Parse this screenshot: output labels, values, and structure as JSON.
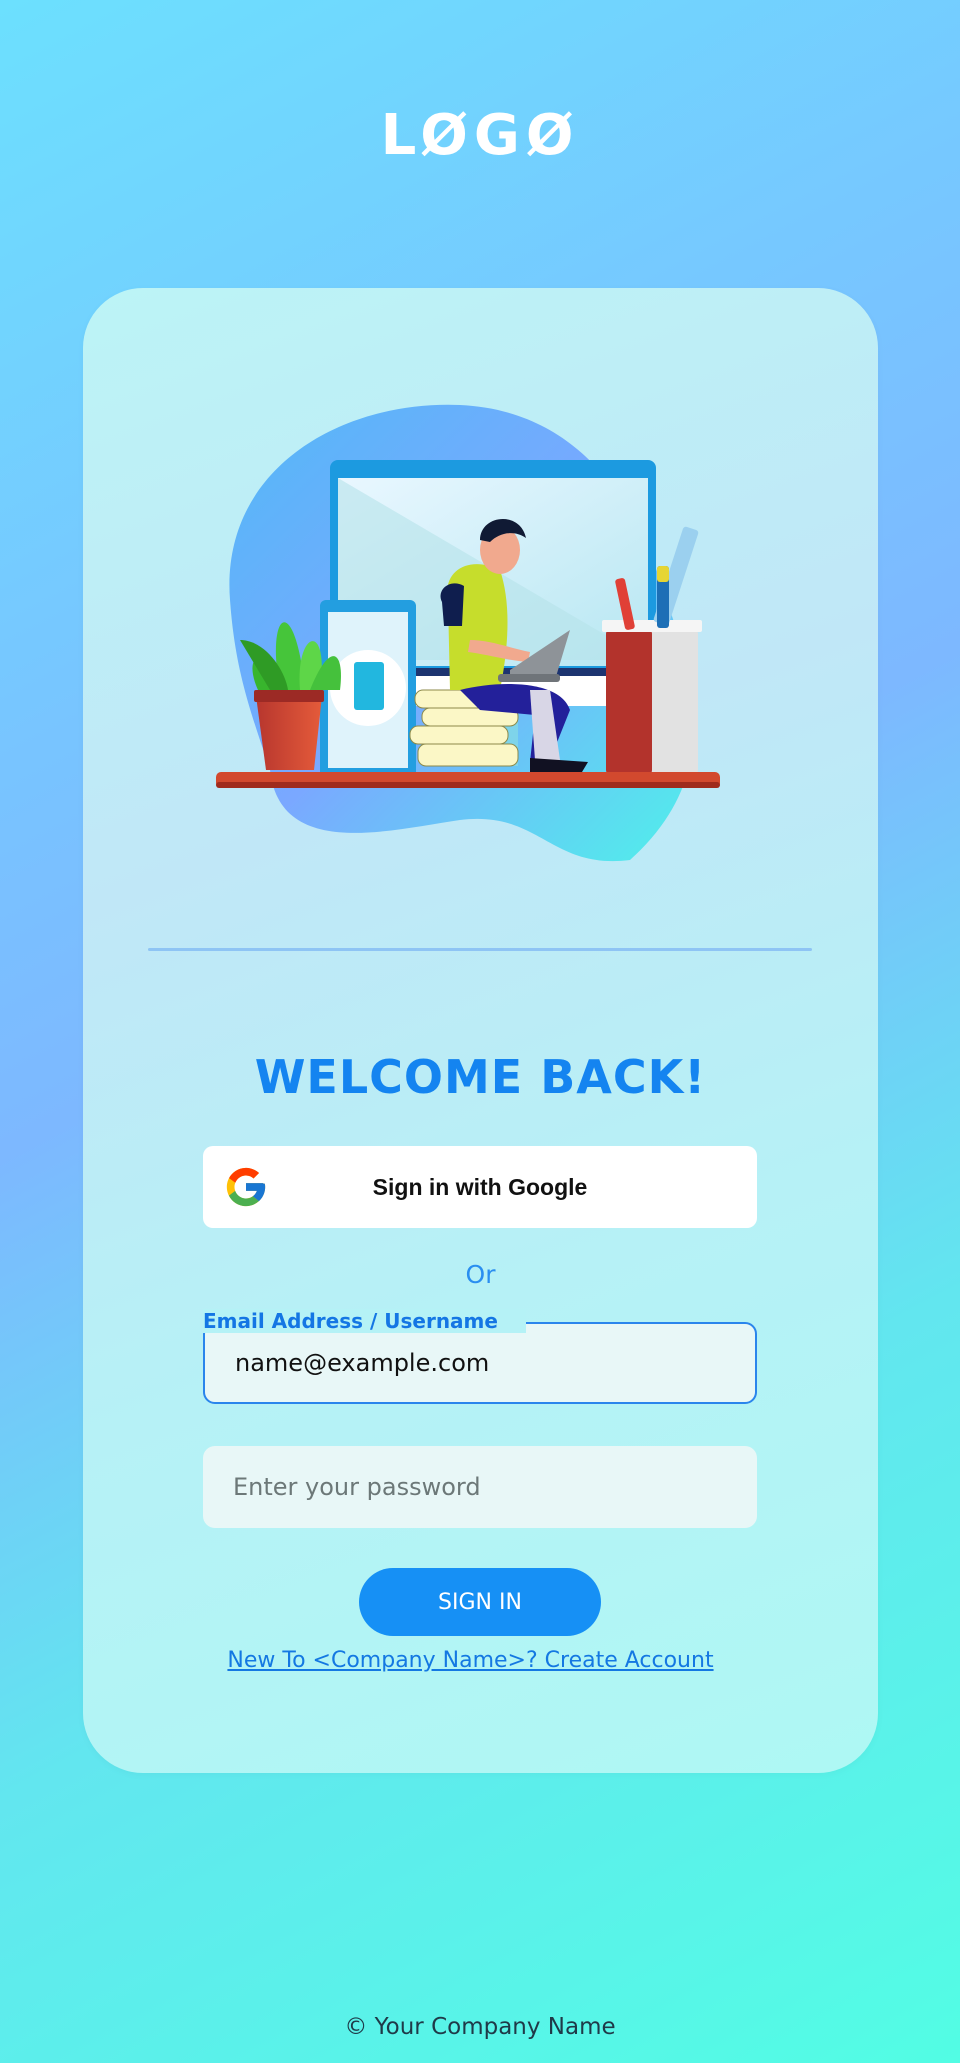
{
  "logo": {
    "text": "LØGØ"
  },
  "illustration": {
    "name": "person-working-on-laptop-illustration"
  },
  "welcome": {
    "title": "WELCOME BACK!"
  },
  "google": {
    "label": "Sign in with Google",
    "icon": "google-icon"
  },
  "divider_text": "Or",
  "email": {
    "label": "Email Address / Username",
    "value": "name@example.com"
  },
  "password": {
    "placeholder": "Enter your password",
    "value": ""
  },
  "signin": {
    "label": "SIGN IN"
  },
  "signup": {
    "text": "New To <Company Name>? Create Account"
  },
  "footer": {
    "text": "© Your Company Name"
  },
  "colors": {
    "accent": "#1690f5",
    "title": "#1484f0",
    "background_top": "#6ce0fe",
    "background_bottom": "#52fde4"
  }
}
